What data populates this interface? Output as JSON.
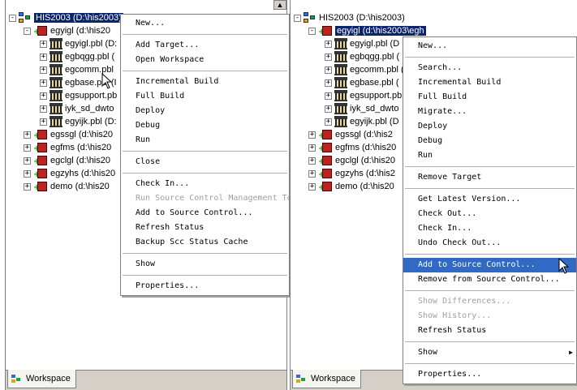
{
  "left": {
    "tree": {
      "root": "HIS2003 (D:\\his2003)",
      "target": "egyigl (d:\\his20",
      "libs": [
        "egyigl.pbl (D:",
        "egbqgg.pbl (",
        "egcomm.pbl",
        "egbase.pbl (I",
        "egsupport.pb",
        "iyk_sd_dwto",
        "egyijk.pbl (D:"
      ],
      "targets": [
        "egssgl (d:\\his20",
        "egfms (d:\\his20",
        "egclgl (d:\\his20",
        "egzyhs (d:\\his20",
        "demo (d:\\his20"
      ]
    },
    "menu": [
      {
        "label": "New...",
        "state": "normal"
      },
      {
        "sep": true
      },
      {
        "label": "Add Target...",
        "state": "normal"
      },
      {
        "label": "Open Workspace",
        "state": "normal"
      },
      {
        "sep": true
      },
      {
        "label": "Incremental Build",
        "state": "normal"
      },
      {
        "label": "Full Build",
        "state": "normal"
      },
      {
        "label": "Deploy",
        "state": "normal"
      },
      {
        "label": "Debug",
        "state": "normal"
      },
      {
        "label": "Run",
        "state": "normal"
      },
      {
        "sep": true
      },
      {
        "label": "Close",
        "state": "normal"
      },
      {
        "sep": true
      },
      {
        "label": "Check In...",
        "state": "normal"
      },
      {
        "label": "Run Source Control Management To",
        "state": "disabled"
      },
      {
        "label": "Add to Source Control...",
        "state": "normal"
      },
      {
        "label": "Refresh Status",
        "state": "normal"
      },
      {
        "label": "Backup Scc Status Cache",
        "state": "normal"
      },
      {
        "sep": true
      },
      {
        "label": "Show",
        "state": "normal"
      },
      {
        "sep": true
      },
      {
        "label": "Properties...",
        "state": "normal"
      }
    ],
    "tab": "Workspace"
  },
  "right": {
    "tree": {
      "root": "HIS2003 (D:\\his2003)",
      "target": "egyigl (d:\\his2003\\egh",
      "libs": [
        "egyigl.pbl (D",
        "egbqgg.pbl (",
        "egcomm.pbl (",
        "egbase.pbl (",
        "egsupport.pb",
        "iyk_sd_dwto",
        "egyijk.pbl (D"
      ],
      "targets": [
        "egssgl (d:\\his2",
        "egfms (d:\\his20",
        "egclgl (d:\\his20",
        "egzyhs (d:\\his2",
        "demo (d:\\his20"
      ]
    },
    "menu": [
      {
        "label": "New...",
        "state": "normal"
      },
      {
        "sep": true
      },
      {
        "label": "Search...",
        "state": "normal"
      },
      {
        "label": "Incremental Build",
        "state": "normal"
      },
      {
        "label": "Full Build",
        "state": "normal"
      },
      {
        "label": "Migrate...",
        "state": "normal"
      },
      {
        "label": "Deploy",
        "state": "normal"
      },
      {
        "label": "Debug",
        "state": "normal"
      },
      {
        "label": "Run",
        "state": "normal"
      },
      {
        "sep": true
      },
      {
        "label": "Remove Target",
        "state": "normal"
      },
      {
        "sep": true
      },
      {
        "label": "Get Latest Version...",
        "state": "normal"
      },
      {
        "label": "Check Out...",
        "state": "normal"
      },
      {
        "label": "Check In...",
        "state": "normal"
      },
      {
        "label": "Undo Check Out...",
        "state": "normal"
      },
      {
        "sep": true
      },
      {
        "label": "Add to Source Control...",
        "state": "highlighted"
      },
      {
        "label": "Remove from Source Control...",
        "state": "normal"
      },
      {
        "sep": true
      },
      {
        "label": "Show Differences...",
        "state": "disabled"
      },
      {
        "label": "Show History...",
        "state": "disabled"
      },
      {
        "label": "Refresh Status",
        "state": "normal"
      },
      {
        "sep": true
      },
      {
        "label": "Show",
        "state": "normal",
        "submenu": true
      },
      {
        "sep": true
      },
      {
        "label": "Properties...",
        "state": "normal"
      }
    ],
    "tab": "Workspace"
  },
  "icons": {
    "workspace": "workspace-icon",
    "target": "target-icon",
    "library": "library-icon",
    "cursor": "arrow-cursor-icon",
    "submenu": "submenu-arrow-icon",
    "scroll_up": "scroll-up-arrow-icon"
  },
  "colors": {
    "selection": "#0a246a",
    "highlight": "#316ac5",
    "disabled": "#a0a0a0"
  }
}
